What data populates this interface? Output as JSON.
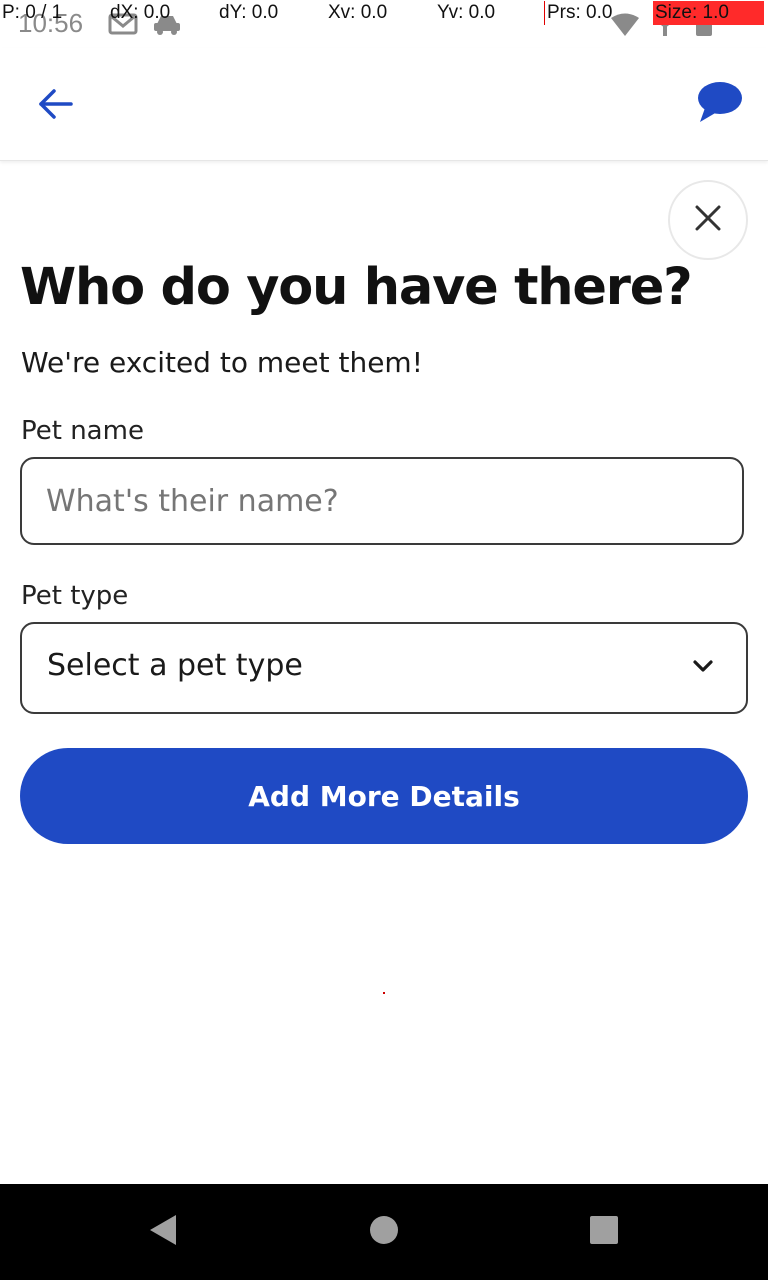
{
  "status_bar": {
    "time": "10:56",
    "icons": [
      "gmail-icon",
      "car-icon",
      "wifi-icon",
      "signal-icon",
      "battery-icon"
    ]
  },
  "pointer_overlay": {
    "p": "P: 0 / 1",
    "dx": "dX: 0.0",
    "dy": "dY: 0.0",
    "xv": "Xv: 0.0",
    "yv": "Yv: 0.0",
    "prs": "Prs: 0.0",
    "size": "Size: 1.0"
  },
  "app_bar": {
    "icons": [
      "back-arrow-icon",
      "chat-bubble-icon"
    ]
  },
  "form": {
    "title": "Who do you have there?",
    "subtitle": "We're excited to meet them!",
    "pet_name": {
      "label": "Pet name",
      "placeholder": "What's their name?",
      "value": ""
    },
    "pet_type": {
      "label": "Pet type",
      "selected": "Select a pet type"
    },
    "submit_label": "Add More Details"
  },
  "nav_bar": {
    "icons": [
      "nav-back-icon",
      "nav-home-icon",
      "nav-recents-icon"
    ]
  },
  "colors": {
    "accent": "#1f4ac4",
    "text": "#111111",
    "border": "#3a3a3a",
    "nav_bar": "#000000"
  }
}
